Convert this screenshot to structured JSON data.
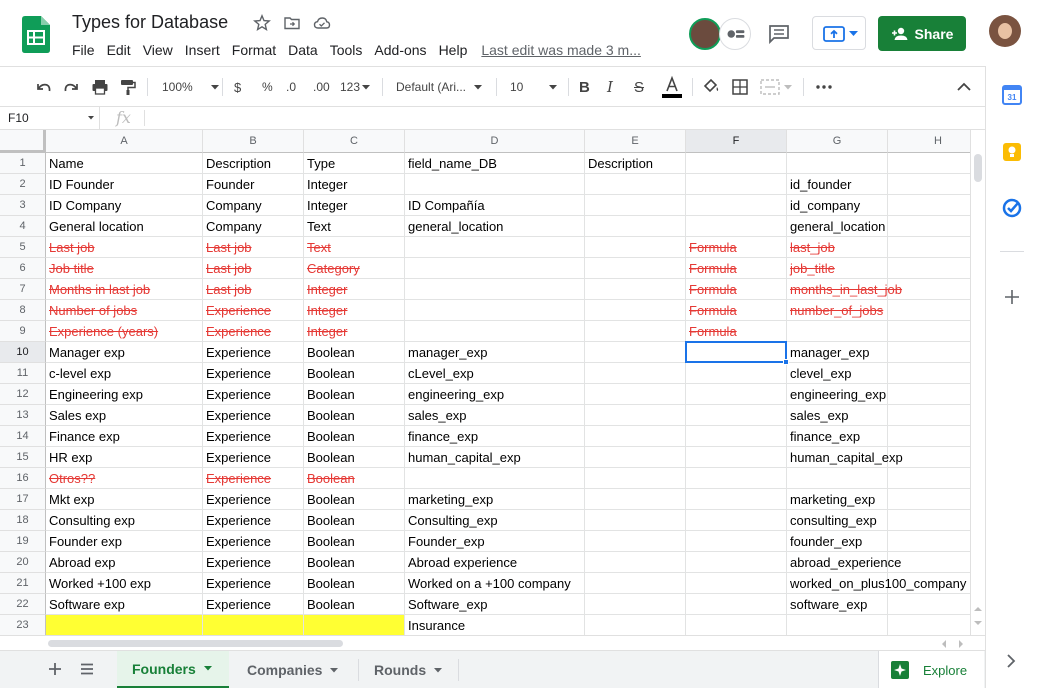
{
  "doc": {
    "title": "Types for Database",
    "last_edit": "Last edit was made 3 m..."
  },
  "menu": [
    "File",
    "Edit",
    "View",
    "Insert",
    "Format",
    "Data",
    "Tools",
    "Add-ons",
    "Help"
  ],
  "share_label": "Share",
  "toolbar": {
    "zoom": "100%",
    "currency": "$",
    "percent": "%",
    "dec_decrease": ".0",
    "dec_increase": ".00",
    "more_formats": "123",
    "font": "Default (Ari...",
    "font_size": "10"
  },
  "formula_bar": {
    "cell_ref": "F10",
    "fx": "fx",
    "value": ""
  },
  "columns": [
    "A",
    "B",
    "C",
    "D",
    "E",
    "F",
    "G",
    "H"
  ],
  "selected_column": "F",
  "selected_row": 10,
  "rows": [
    {
      "n": "1",
      "cells": [
        "Name",
        "Description",
        "Type",
        "field_name_DB",
        "Description",
        "",
        "",
        ""
      ],
      "strike": false
    },
    {
      "n": "2",
      "cells": [
        "ID Founder",
        "Founder",
        "Integer",
        "",
        "",
        "",
        "id_founder",
        ""
      ],
      "strike": false
    },
    {
      "n": "3",
      "cells": [
        "ID Company",
        "Company",
        "Integer",
        "ID Compañía",
        "",
        "",
        "id_company",
        ""
      ],
      "strike": false
    },
    {
      "n": "4",
      "cells": [
        "General location",
        "Company",
        "Text",
        "general_location",
        "",
        "",
        "general_location",
        ""
      ],
      "strike": false
    },
    {
      "n": "5",
      "cells": [
        "Last job",
        "Last job",
        "Text",
        "",
        "",
        "Formula",
        "last_job",
        ""
      ],
      "strike": true
    },
    {
      "n": "6",
      "cells": [
        "Job title",
        "Last job",
        "Category",
        "",
        "",
        "Formula",
        "job_title",
        ""
      ],
      "strike": true
    },
    {
      "n": "7",
      "cells": [
        "Months in last job",
        "Last job",
        "Integer",
        "",
        "",
        "Formula",
        "months_in_last_job",
        ""
      ],
      "strike": true
    },
    {
      "n": "8",
      "cells": [
        "Number of jobs",
        "Experience",
        "Integer",
        "",
        "",
        "Formula",
        "number_of_jobs",
        ""
      ],
      "strike": true
    },
    {
      "n": "9",
      "cells": [
        "Experience (years)",
        "Experience",
        "Integer",
        "",
        "",
        "Formula",
        "",
        ""
      ],
      "strike": true
    },
    {
      "n": "10",
      "cells": [
        "Manager exp",
        "Experience",
        "Boolean",
        "manager_exp",
        "",
        "",
        "manager_exp",
        ""
      ],
      "strike": false
    },
    {
      "n": "11",
      "cells": [
        "c-level exp",
        "Experience",
        "Boolean",
        "cLevel_exp",
        "",
        "",
        "clevel_exp",
        ""
      ],
      "strike": false
    },
    {
      "n": "12",
      "cells": [
        "Engineering exp",
        "Experience",
        "Boolean",
        "engineering_exp",
        "",
        "",
        "engineering_exp",
        ""
      ],
      "strike": false
    },
    {
      "n": "13",
      "cells": [
        "Sales exp",
        "Experience",
        "Boolean",
        "sales_exp",
        "",
        "",
        "sales_exp",
        ""
      ],
      "strike": false
    },
    {
      "n": "14",
      "cells": [
        "Finance exp",
        "Experience",
        "Boolean",
        "finance_exp",
        "",
        "",
        "finance_exp",
        ""
      ],
      "strike": false
    },
    {
      "n": "15",
      "cells": [
        "HR exp",
        "Experience",
        "Boolean",
        "human_capital_exp",
        "",
        "",
        "human_capital_exp",
        ""
      ],
      "strike": false
    },
    {
      "n": "16",
      "cells": [
        "Otros??",
        "Experience",
        "Boolean",
        "",
        "",
        "",
        "",
        ""
      ],
      "strike": true
    },
    {
      "n": "17",
      "cells": [
        "Mkt exp",
        "Experience",
        "Boolean",
        "marketing_exp",
        "",
        "",
        "marketing_exp",
        ""
      ],
      "strike": false
    },
    {
      "n": "18",
      "cells": [
        "Consulting exp",
        "Experience",
        "Boolean",
        "Consulting_exp",
        "",
        "",
        "consulting_exp",
        ""
      ],
      "strike": false
    },
    {
      "n": "19",
      "cells": [
        "Founder exp",
        "Experience",
        "Boolean",
        "Founder_exp",
        "",
        "",
        "founder_exp",
        ""
      ],
      "strike": false
    },
    {
      "n": "20",
      "cells": [
        "Abroad exp",
        "Experience",
        "Boolean",
        "Abroad experience",
        "",
        "",
        "abroad_experience",
        ""
      ],
      "strike": false
    },
    {
      "n": "21",
      "cells": [
        "Worked +100 exp",
        "Experience",
        "Boolean",
        "Worked on a +100 company",
        "",
        "",
        "worked_on_plus100_company",
        ""
      ],
      "strike": false
    },
    {
      "n": "22",
      "cells": [
        "Software exp",
        "Experience",
        "Boolean",
        "Software_exp",
        "",
        "",
        "software_exp",
        ""
      ],
      "strike": false
    },
    {
      "n": "23",
      "cells": [
        "",
        "",
        "",
        "Insurance",
        "",
        "",
        "",
        ""
      ],
      "strike": false,
      "yellow_cols": [
        0,
        1,
        2
      ]
    }
  ],
  "sheets": [
    {
      "label": "Founders",
      "active": true
    },
    {
      "label": "Companies",
      "active": false
    },
    {
      "label": "Rounds",
      "active": false
    }
  ],
  "explore_label": "Explore",
  "colors": {
    "brand_green": "#188038",
    "strike_red": "#e53935",
    "highlight_yellow": "#ffff33",
    "selection_blue": "#1a73e8"
  },
  "icons": [
    "sheets-logo-icon",
    "star-icon",
    "move-to-folder-icon",
    "cloud-saved-icon",
    "comment-icon",
    "present-icon",
    "undo-icon",
    "redo-icon",
    "print-icon",
    "paint-format-icon",
    "bold-icon",
    "italic-icon",
    "strikethrough-icon",
    "text-color-icon",
    "fill-color-icon",
    "borders-icon",
    "merge-cells-icon",
    "more-icon",
    "collapse-icon",
    "calendar-icon",
    "keep-icon",
    "tasks-icon",
    "add-icon",
    "add-sheet-icon",
    "all-sheets-icon",
    "explore-icon"
  ]
}
